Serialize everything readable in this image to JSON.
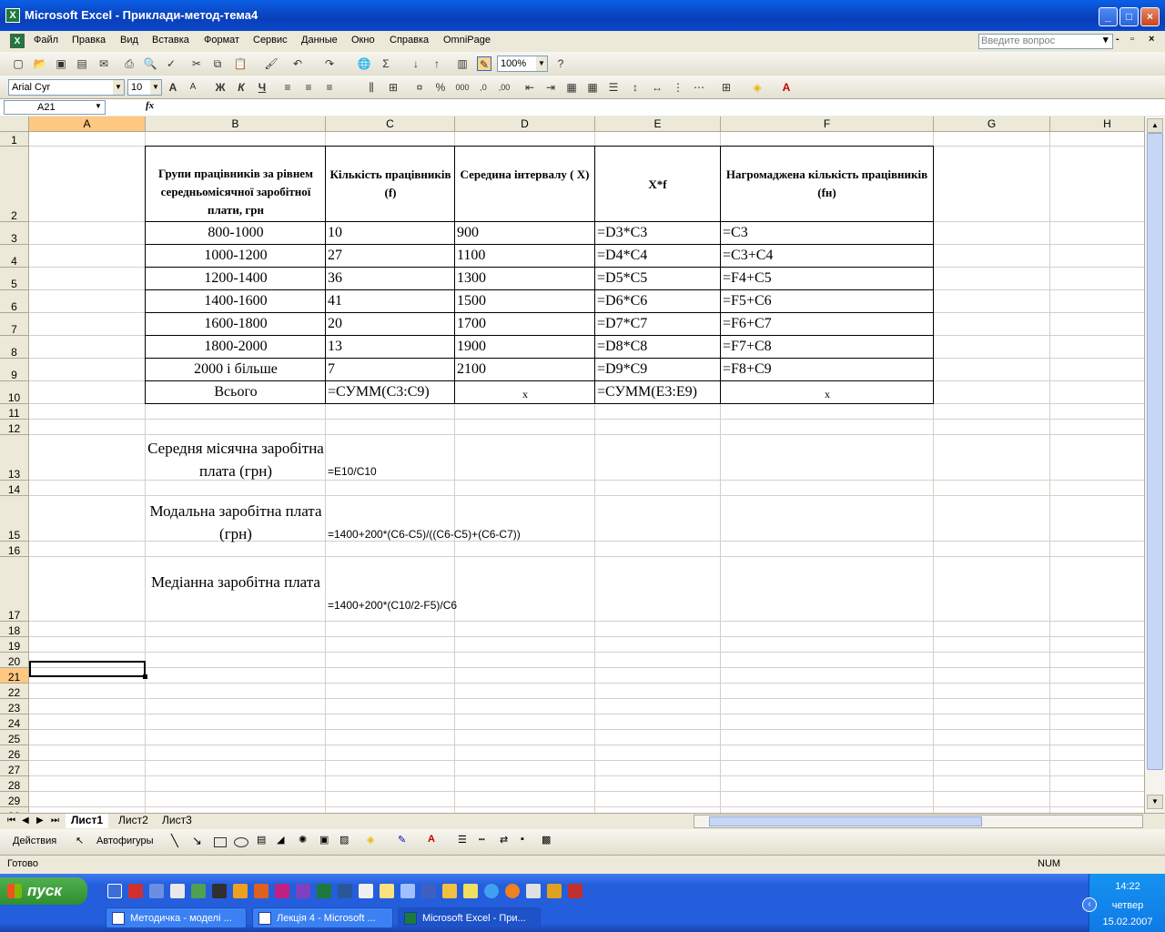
{
  "window": {
    "title": "Microsoft Excel - Приклади-метод-тема4",
    "app_icon": "excel-icon"
  },
  "menu": [
    "Файл",
    "Правка",
    "Вид",
    "Вставка",
    "Формат",
    "Сервис",
    "Данные",
    "Окно",
    "Справка",
    "OmniPage"
  ],
  "ask_placeholder": "Введите вопрос",
  "toolbar": {
    "zoom": "100%",
    "font": "Arial Cyr",
    "font_size": "10",
    "bold": "Ж",
    "italic": "К",
    "underline": "Ч"
  },
  "formula_bar": {
    "name_box": "A21",
    "fx": "fx",
    "content": ""
  },
  "columns": [
    "A",
    "B",
    "C",
    "D",
    "E",
    "F",
    "G",
    "H"
  ],
  "rows": [
    "1",
    "2",
    "3",
    "4",
    "5",
    "6",
    "7",
    "8",
    "9",
    "10",
    "11",
    "12",
    "13",
    "14",
    "15",
    "16",
    "17",
    "18",
    "19",
    "20",
    "21",
    "22",
    "23",
    "24",
    "25",
    "26",
    "27",
    "28",
    "29",
    "30"
  ],
  "table": {
    "headers": [
      "Групи працівників за рівнем середньомісячної заробітної плати, грн",
      "Кількість працівників (f)",
      "Середина інтервалу ( X)",
      "X*f",
      "Нагромаджена кількість працівників (fн)"
    ],
    "rows": [
      [
        "800-1000",
        "10",
        "900",
        "=D3*C3",
        "=C3"
      ],
      [
        "1000-1200",
        "27",
        "1100",
        "=D4*C4",
        "=C3+C4"
      ],
      [
        "1200-1400",
        "36",
        "1300",
        "=D5*C5",
        "=F4+C5"
      ],
      [
        "1400-1600",
        "41",
        "1500",
        "=D6*C6",
        "=F5+C6"
      ],
      [
        "1600-1800",
        "20",
        "1700",
        "=D7*C7",
        "=F6+C7"
      ],
      [
        "1800-2000",
        "13",
        "1900",
        "=D8*C8",
        "=F7+C8"
      ],
      [
        "2000 і більше",
        "7",
        "2100",
        "=D9*C9",
        "=F8+C9"
      ]
    ],
    "total": [
      "Всього",
      "=СУММ(C3:C9)",
      "x",
      "=СУММ(E3:E9)",
      "x"
    ]
  },
  "stats": [
    {
      "label": "Середня місячна заробітна плата (грн)",
      "formula": "=E10/C10"
    },
    {
      "label": "Модальна заробітна плата (грн)",
      "formula": "=1400+200*(C6-C5)/((C6-C5)+(C6-C7))"
    },
    {
      "label": "Медіанна заробітна плата",
      "formula": "=1400+200*(C10/2-F5)/C6"
    }
  ],
  "sheets": [
    "Лист1",
    "Лист2",
    "Лист3"
  ],
  "draw_toolbar": {
    "actions": "Действия",
    "autoshapes": "Автофигуры"
  },
  "status": {
    "left": "Готово",
    "num": "NUM"
  },
  "taskbar": {
    "start": "пуск",
    "tasks": [
      "Методичка - моделі ...",
      "Лекція 4 - Microsoft ...",
      "Microsoft Excel - При..."
    ],
    "clock": {
      "time": "14:22",
      "day": "четвер",
      "date": "15.02.2007"
    }
  }
}
